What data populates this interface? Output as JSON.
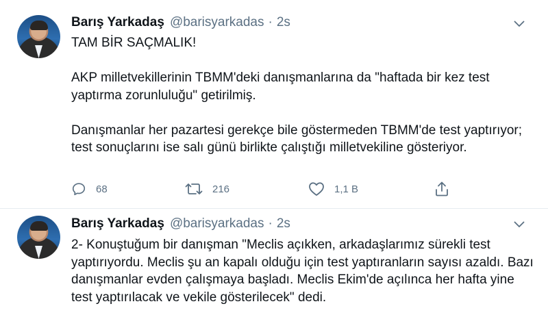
{
  "tweets": [
    {
      "author_name": "Barış Yarkadaş",
      "author_handle": "@barisyarkadas",
      "separator": "·",
      "time": "2s",
      "paragraphs": [
        "TAM BİR SAÇMALIK!",
        "AKP milletvekillerinin TBMM'deki danışmanlarına da \"haftada bir kez test yaptırma zorunluluğu\" getirilmiş.",
        "Danışmanlar her pazartesi gerekçe bile göstermeden TBMM'de test yaptırıyor; test sonuçlarını ise salı günü birlikte çalıştığı milletvekiline gösteriyor."
      ],
      "actions": {
        "reply_count": "68",
        "retweet_count": "216",
        "like_count": "1,1 B"
      }
    },
    {
      "author_name": "Barış Yarkadaş",
      "author_handle": "@barisyarkadas",
      "separator": "·",
      "time": "2s",
      "paragraphs": [
        "2- Konuştuğum bir danışman \"Meclis açıkken, arkadaşlarımız sürekli test yaptırıyordu. Meclis şu an kapalı olduğu için test yaptıranların sayısı azaldı. Bazı danışmanlar evden çalışmaya başladı. Meclis Ekim'de açılınca her hafta yine test yaptırılacak ve vekile gösterilecek\" dedi."
      ]
    }
  ],
  "icons": {
    "reply": "reply-icon",
    "retweet": "retweet-icon",
    "like": "heart-icon",
    "share": "share-icon",
    "more": "chevron-down-icon"
  },
  "colors": {
    "text": "#0f1419",
    "secondary": "#5b7083",
    "divider": "#e6ecf0"
  }
}
